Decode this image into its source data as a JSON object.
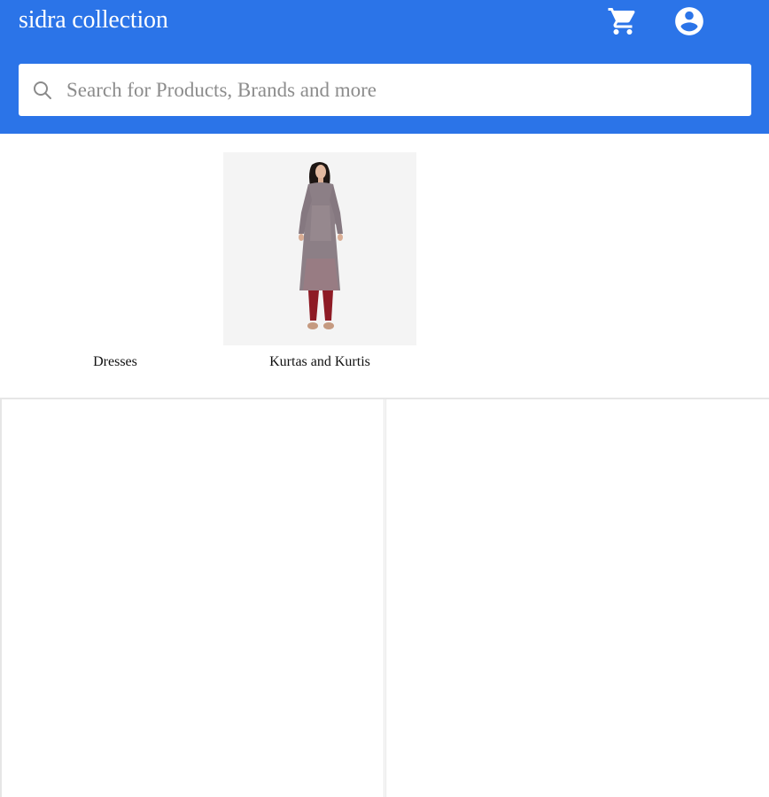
{
  "header": {
    "title": "sidra collection",
    "cart_icon": "cart-icon",
    "account_icon": "account-circle-icon",
    "background_color": "#2b74e8"
  },
  "search": {
    "placeholder": "Search for Products, Brands and more",
    "value": "",
    "icon": "search-icon"
  },
  "categories": [
    {
      "label": "Dresses",
      "image": "none"
    },
    {
      "label": "Kurtas and Kurtis",
      "image": "woman-in-printed-kurta"
    }
  ]
}
